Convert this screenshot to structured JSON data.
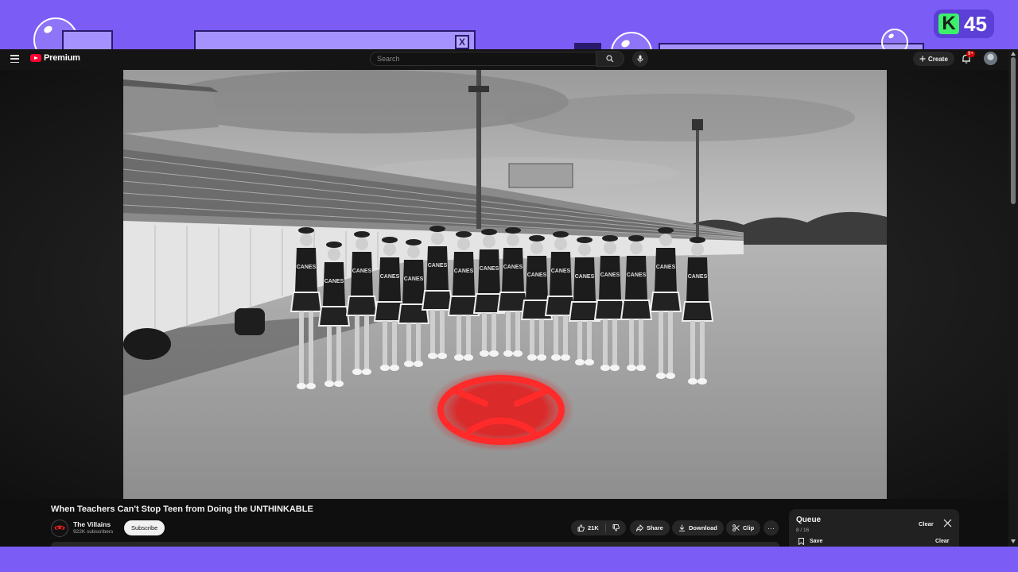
{
  "overlay": {
    "counter_value": "45",
    "counter_logo": "K",
    "close_glyph": "X"
  },
  "header": {
    "logo_text": "Premium",
    "search_placeholder": "Search",
    "create_label": "Create",
    "notification_count": "9+"
  },
  "video": {
    "title": "When Teachers Can't Stop Teen from Doing the UNTHINKABLE",
    "jersey_text": "CANES",
    "overlay_icon": "angry-face-icon"
  },
  "channel": {
    "name": "The Villains",
    "subscribers": "922K subscribers",
    "subscribe_label": "Subscribe"
  },
  "actions": {
    "like_count": "21K",
    "share_label": "Share",
    "download_label": "Download",
    "clip_label": "Clip",
    "more_glyph": "···"
  },
  "queue": {
    "title": "Queue",
    "position": "8 / 16",
    "clear_label": "Clear",
    "save_label": "Save",
    "clear_label_2": "Clear"
  },
  "colors": {
    "frame_purple": "#7b5cf5",
    "youtube_red": "#ff0033",
    "counter_green": "#3cf06a",
    "overlay_red": "#e11d1d"
  }
}
